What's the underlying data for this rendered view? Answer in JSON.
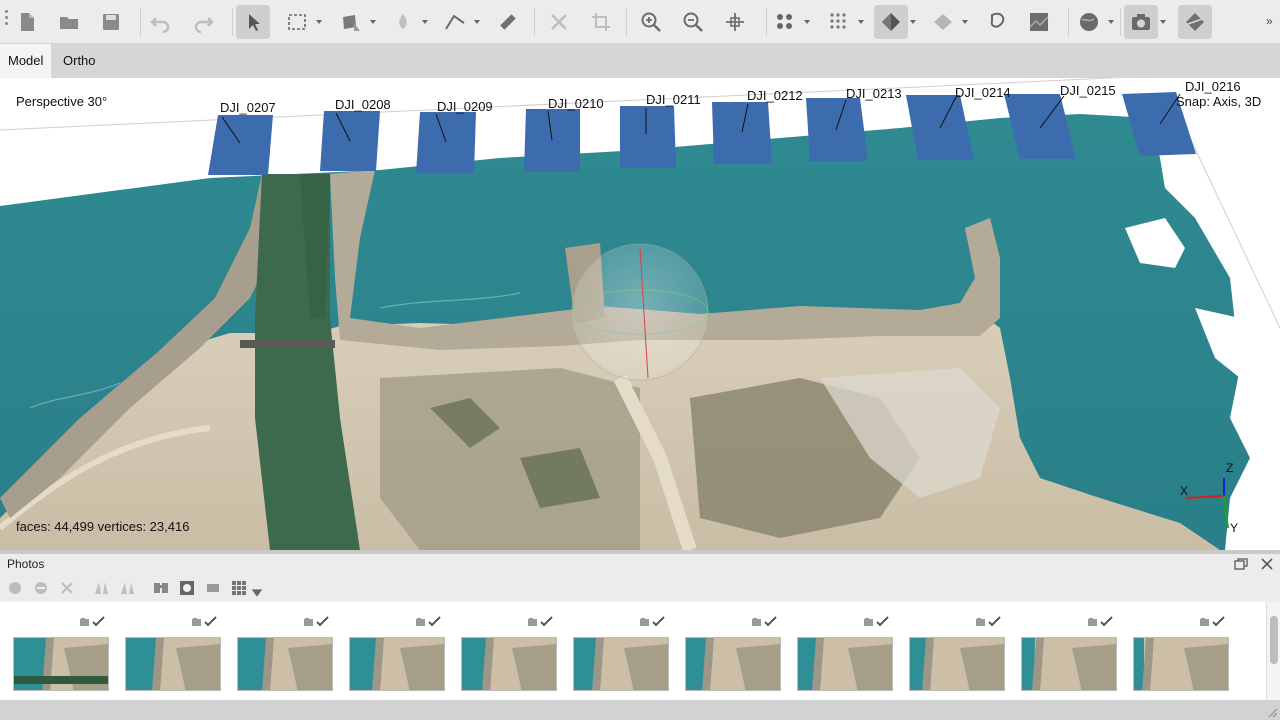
{
  "toolbar": {
    "buttons": [
      {
        "icon": "new-document-icon"
      },
      {
        "icon": "open-folder-icon"
      },
      {
        "icon": "save-icon"
      },
      {
        "icon": "undo-icon"
      },
      {
        "icon": "redo-icon"
      },
      {
        "icon": "navigation-pointer-icon"
      },
      {
        "icon": "rectangle-selection-icon"
      },
      {
        "icon": "shape-selection-icon"
      },
      {
        "icon": "point-marker-icon"
      },
      {
        "icon": "polyline-measure-icon"
      },
      {
        "icon": "ruler-icon"
      },
      {
        "icon": "delete-selection-icon"
      },
      {
        "icon": "crop-selection-icon"
      },
      {
        "icon": "zoom-in-icon"
      },
      {
        "icon": "zoom-out-icon"
      },
      {
        "icon": "move-object-icon"
      },
      {
        "icon": "show-points-icon"
      },
      {
        "icon": "dense-cloud-icon"
      },
      {
        "icon": "model-shaded-icon"
      },
      {
        "icon": "model-solid-icon"
      },
      {
        "icon": "tiled-model-icon"
      },
      {
        "icon": "orthomosaic-icon"
      },
      {
        "icon": "globe-icon"
      },
      {
        "icon": "show-cameras-icon"
      },
      {
        "icon": "region-icon"
      }
    ],
    "overflow_glyph": "»"
  },
  "tabs": [
    {
      "label": "Model",
      "selected": true
    },
    {
      "label": "Ortho",
      "selected": false
    }
  ],
  "viewport": {
    "projection_label": "Perspective 30°",
    "snap_label": "Snap: Axis, 3D",
    "stats_label": "faces: 44,499 vertices: 23,416",
    "cameras": [
      "DJI_0207",
      "DJI_0208",
      "DJI_0209",
      "DJI_0210",
      "DJI_0211",
      "DJI_0212",
      "DJI_0213",
      "DJI_0214",
      "DJI_0215",
      "DJI_0216"
    ],
    "axes": {
      "x": "X",
      "y": "Y",
      "z": "Z"
    },
    "colors": {
      "camera": "#3c6bae",
      "water": "#2e8f95",
      "sand": "#cfc3ac",
      "channel": "#3d6a4c"
    }
  },
  "photos": {
    "title": "Photos",
    "tools": [
      "enable-camera-icon",
      "disable-camera-icon",
      "remove-camera-icon",
      "reset-view-icon",
      "filter-icon",
      "mask-icon",
      "image-icon",
      "details-icon",
      "grid-view-icon"
    ],
    "count": 11
  }
}
